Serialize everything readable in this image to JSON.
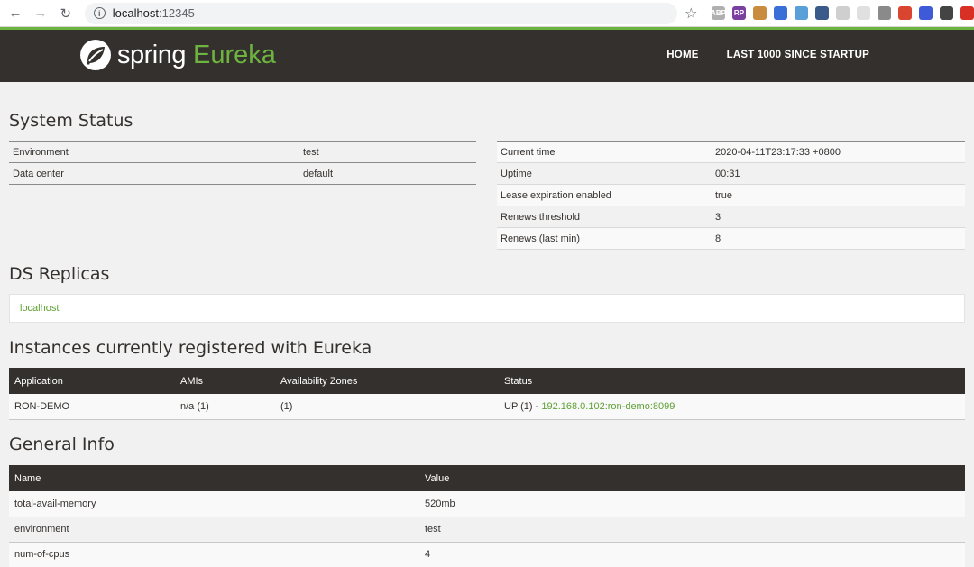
{
  "browser": {
    "back_glyph": "←",
    "forward_glyph": "→",
    "reload_glyph": "↻",
    "address": "localhost",
    "address_port": ":12345",
    "info_glyph": "i",
    "star_glyph": "☆",
    "extensions": [
      {
        "icon": "adblock-icon",
        "label": "ABP",
        "color": "#b0b0b0"
      },
      {
        "icon": "rp-icon",
        "label": "RP",
        "color": "#7b3fa0"
      },
      {
        "icon": "cookie-icon",
        "label": "",
        "color": "#c98b3e"
      },
      {
        "icon": "pocket-icon",
        "label": "",
        "color": "#3a6fd8"
      },
      {
        "icon": "compass-icon",
        "label": "",
        "color": "#5aa0d8"
      },
      {
        "icon": "frame-icon",
        "label": "",
        "color": "#3a5a8a"
      },
      {
        "icon": "ghost-icon",
        "label": "",
        "color": "#cfcfcf"
      },
      {
        "icon": "square-icon",
        "label": "",
        "color": "#e0e0e0"
      },
      {
        "icon": "vue-icon",
        "label": "",
        "color": "#8a8a8a"
      },
      {
        "icon": "s-icon",
        "label": "",
        "color": "#d9452f"
      },
      {
        "icon": "s-blue-icon",
        "label": "",
        "color": "#3f5ad8"
      },
      {
        "icon": "ball-icon",
        "label": "",
        "color": "#444444"
      },
      {
        "icon": "red-circle-icon",
        "label": "",
        "color": "#d93025"
      }
    ]
  },
  "header": {
    "brand_spring": "spring",
    "brand_eureka": "Eureka",
    "nav": [
      "HOME",
      "LAST 1000 SINCE STARTUP"
    ]
  },
  "system_status": {
    "title": "System Status",
    "left": [
      {
        "k": "Environment",
        "v": "test"
      },
      {
        "k": "Data center",
        "v": "default"
      }
    ],
    "right": [
      {
        "k": "Current time",
        "v": "2020-04-11T23:17:33 +0800"
      },
      {
        "k": "Uptime",
        "v": "00:31"
      },
      {
        "k": "Lease expiration enabled",
        "v": "true"
      },
      {
        "k": "Renews threshold",
        "v": "3"
      },
      {
        "k": "Renews (last min)",
        "v": "8"
      }
    ]
  },
  "replicas": {
    "title": "DS Replicas",
    "items": [
      "localhost"
    ]
  },
  "instances": {
    "title": "Instances currently registered with Eureka",
    "headers": [
      "Application",
      "AMIs",
      "Availability Zones",
      "Status"
    ],
    "rows": [
      {
        "application": "RON-DEMO",
        "amis": "n/a (1)",
        "zones": "(1)",
        "status_prefix": "UP (1) - ",
        "status_link": "192.168.0.102:ron-demo:8099"
      }
    ]
  },
  "general_info": {
    "title": "General Info",
    "headers": [
      "Name",
      "Value"
    ],
    "rows": [
      {
        "name": "total-avail-memory",
        "value": "520mb"
      },
      {
        "name": "environment",
        "value": "test"
      },
      {
        "name": "num-of-cpus",
        "value": "4"
      }
    ]
  }
}
